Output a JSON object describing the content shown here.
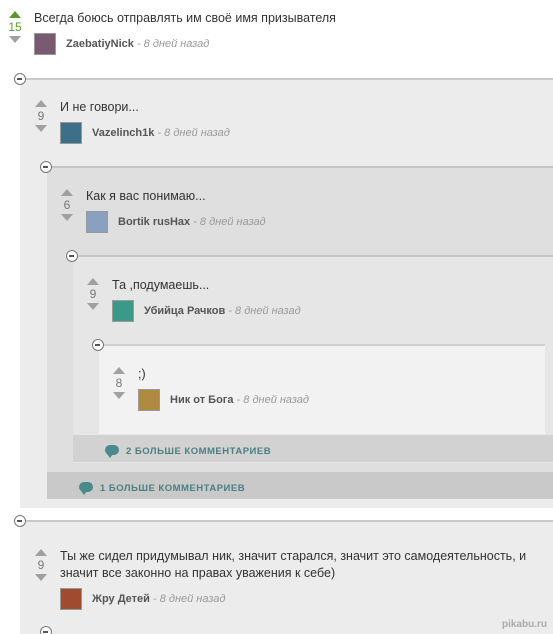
{
  "comments": [
    {
      "score": "15",
      "text": "Всегда боюсь отправлять им своё имя призывателя",
      "nick": "ZaebatiyNick",
      "time": "- 8 дней назад",
      "avatar_color": "#7a5a70"
    },
    {
      "score": "9",
      "text": "И не говори...",
      "nick": "Vazelinch1k",
      "time": "- 8 дней назад",
      "avatar_color": "#3d6f8a"
    },
    {
      "score": "6",
      "text": "Как я вас понимаю...",
      "nick": "Bortik rusHax",
      "time": "- 8 дней назад",
      "avatar_color": "#8aa0c0"
    },
    {
      "score": "9",
      "text": "Та ,подумаешь...",
      "nick": "Убийца Рачков",
      "time": "- 8 дней назад",
      "avatar_color": "#3a9a8a"
    },
    {
      "score": "8",
      "text": ";)",
      "nick": "Ник от Бога",
      "time": "- 8 дней назад",
      "avatar_color": "#b08a40"
    },
    {
      "score": "9",
      "text_line1": "Ты же сидел придумывал ник, значит старался, значит это самодеятельность, и",
      "text_line2": "значит все законно на правах уважения к себе)",
      "nick": "Жру Детей",
      "time": "- 8 дней назад",
      "avatar_color": "#a04a30"
    }
  ],
  "more_links": {
    "more2": "2 БОЛЬШЕ КОММЕНТАРИЕВ",
    "more1": "1 БОЛЬШЕ КОММЕНТАРИЕВ"
  },
  "watermark": "pikabu.ru"
}
